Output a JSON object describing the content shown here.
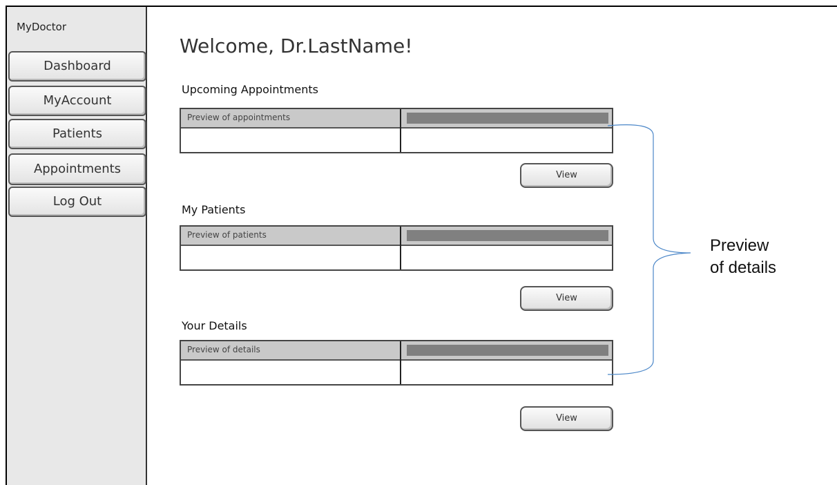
{
  "app": {
    "name": "MyDoctor"
  },
  "sidebar": {
    "items": [
      {
        "label": "Dashboard"
      },
      {
        "label": "MyAccount"
      },
      {
        "label": "Patients"
      },
      {
        "label": "Appointments"
      },
      {
        "label": "Log Out"
      }
    ]
  },
  "main": {
    "welcome": "Welcome, Dr.LastName!",
    "sections": [
      {
        "title": "Upcoming Appointments",
        "preview_label": "Preview of appointments",
        "button_label": "View"
      },
      {
        "title": "My Patients",
        "preview_label": "Preview of patients",
        "button_label": "View"
      },
      {
        "title": "Your Details",
        "preview_label": "Preview of details",
        "button_label": "View"
      }
    ]
  },
  "annotation": {
    "line1": "Preview",
    "line2": "of details",
    "color": "#4a86c8"
  }
}
